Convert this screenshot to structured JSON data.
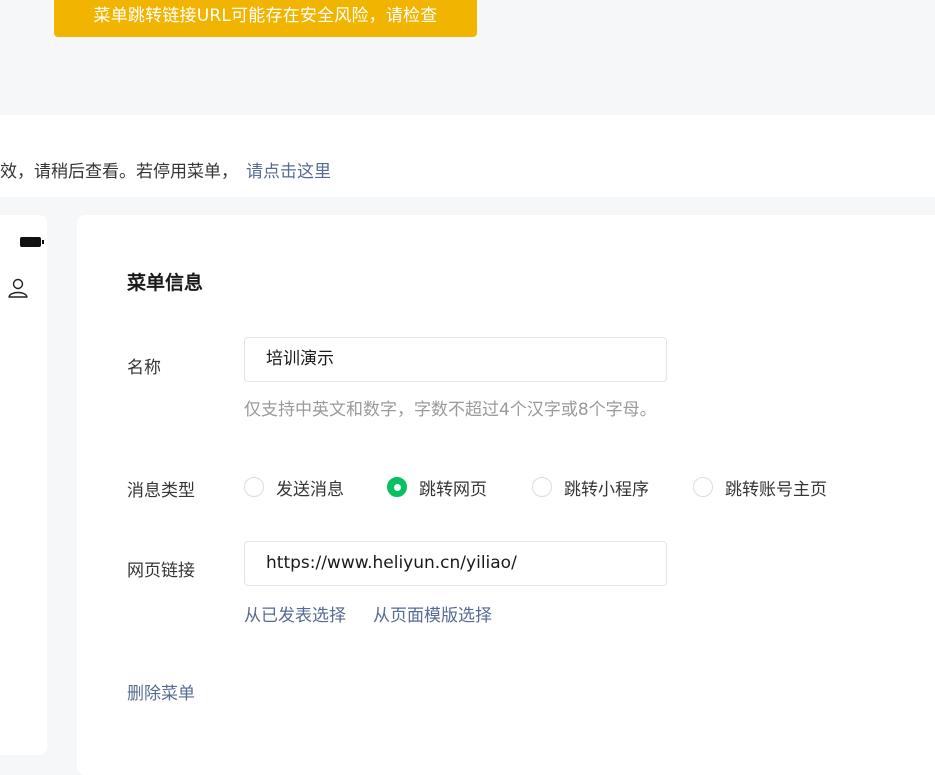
{
  "toast": {
    "text": "菜单跳转链接URL可能存在安全风险，请检查",
    "color": "#f1b400"
  },
  "notice": {
    "text": "效，请稍后查看。若停用菜单，",
    "link": "请点击这里"
  },
  "phone_preview": {
    "icons": [
      "battery-icon",
      "user-icon"
    ]
  },
  "menu_info": {
    "title": "菜单信息",
    "name": {
      "label": "名称",
      "value": "培训演示",
      "hint": "仅支持中英文和数字，字数不超过4个汉字或8个字母。"
    },
    "message_type": {
      "label": "消息类型",
      "options": [
        {
          "label": "发送消息",
          "checked": false
        },
        {
          "label": "跳转网页",
          "checked": true
        },
        {
          "label": "跳转小程序",
          "checked": false
        },
        {
          "label": "跳转账号主页",
          "checked": false
        }
      ]
    },
    "web_link": {
      "label": "网页链接",
      "value": "https://www.heliyun.cn/yiliao/",
      "choose_published": "从已发表选择",
      "choose_template": "从页面模版选择"
    },
    "delete_label": "删除菜单"
  },
  "colors": {
    "accent_green": "#07c160",
    "link_blue": "#576b95",
    "warning_yellow": "#f1b400"
  }
}
